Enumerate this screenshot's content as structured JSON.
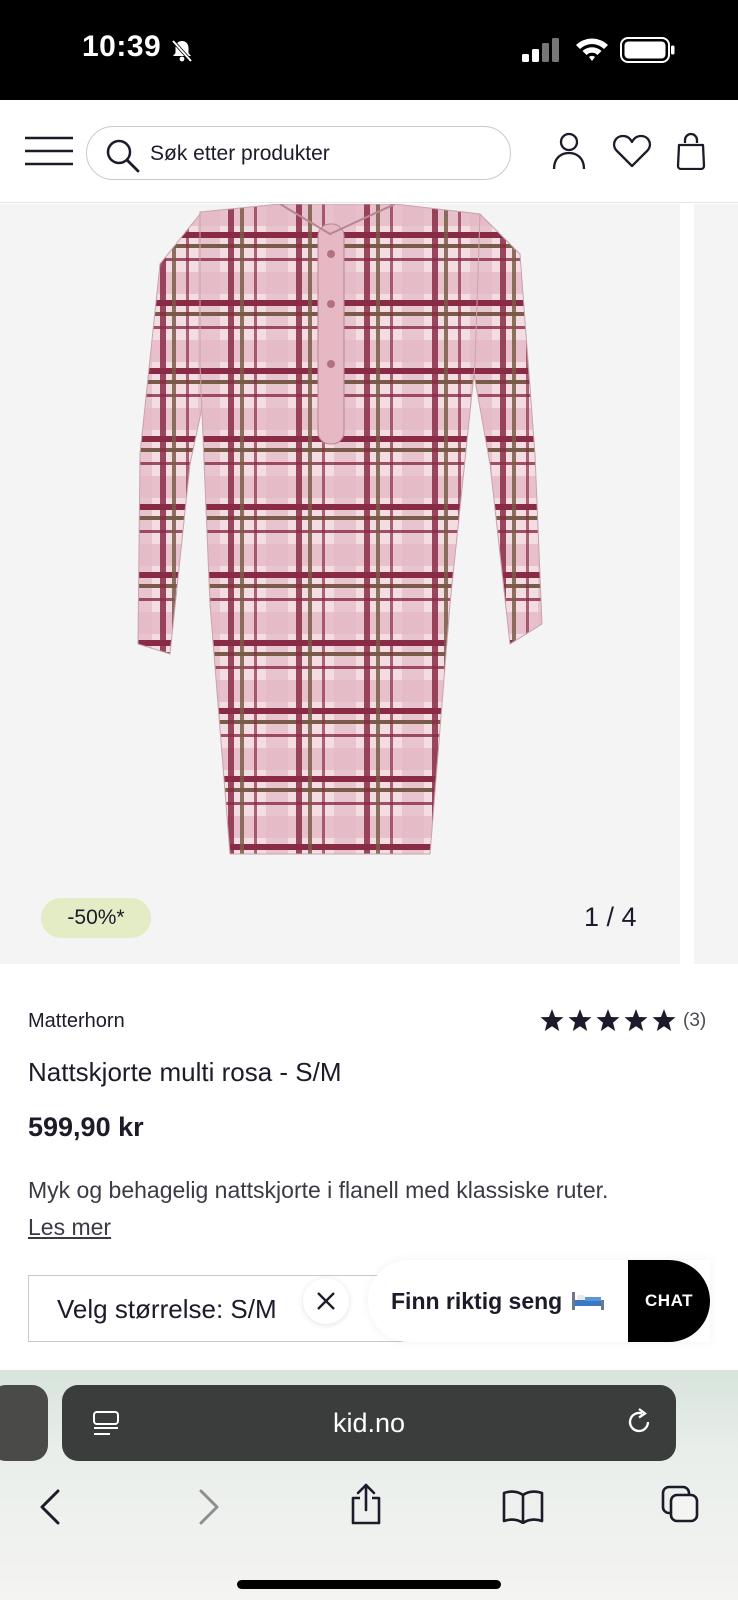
{
  "status_bar": {
    "time": "10:39"
  },
  "header": {
    "search_placeholder": "Søk etter produkter",
    "icons": [
      "menu-icon",
      "search-icon",
      "account-icon",
      "heart-icon",
      "bag-icon"
    ]
  },
  "gallery": {
    "discount": "-50%*",
    "counter": "1 / 4"
  },
  "product": {
    "brand": "Matterhorn",
    "rating_stars": 5,
    "rating_count": "(3)",
    "title": "Nattskjorte multi rosa - S/M",
    "price": "599,90 kr",
    "description": "Myk og behagelig nattskjorte i flanell med klassiske ruter.",
    "read_more": "Les mer",
    "size_label": "Velg størrelse: S/M"
  },
  "chat": {
    "prompt": "Finn riktig seng",
    "button": "CHAT"
  },
  "browser": {
    "url": "kid.no"
  },
  "colors": {
    "badge_bg": "#e4ecc6",
    "accent": "#000000",
    "plaid_red": "#8a2b45",
    "plaid_pink": "#e9bfca"
  }
}
